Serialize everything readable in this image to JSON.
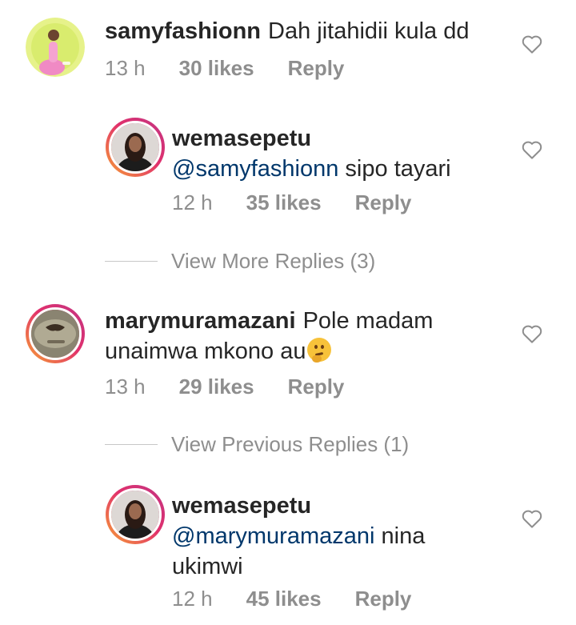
{
  "comments": [
    {
      "username": "samyfashionn",
      "text": "Dah jitahidii kula dd",
      "time": "13 h",
      "likes": "30 likes",
      "reply": "Reply"
    },
    {
      "username": "wemasepetu",
      "mention": "@samyfashionn",
      "text": " sipo tayari",
      "time": "12 h",
      "likes": "35 likes",
      "reply": "Reply"
    },
    {
      "username": "marymuramazani",
      "text_line1": "Pole madam",
      "text_line2": "unaimwa mkono au",
      "emoji": "thinking-face",
      "time": "13 h",
      "likes": "29 likes",
      "reply": "Reply"
    },
    {
      "username": "wemasepetu",
      "mention": "@marymuramazani",
      "text": " nina ukimwi",
      "time": "12 h",
      "likes": "45 likes",
      "reply": "Reply"
    }
  ],
  "view_more_replies": "View More Replies (3)",
  "view_previous_replies": "View Previous Replies (1)",
  "colors": {
    "text": "#262626",
    "meta": "#8e8e8e",
    "mention": "#00376b",
    "story_ring_start": "#f7a134",
    "story_ring_end": "#c13584"
  }
}
